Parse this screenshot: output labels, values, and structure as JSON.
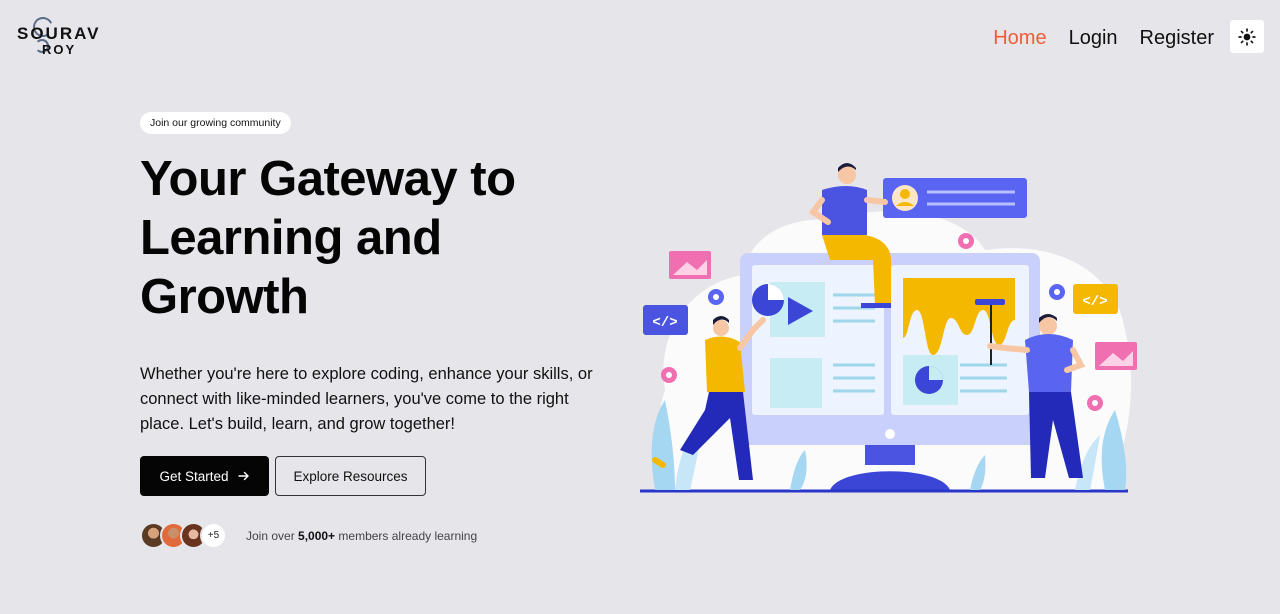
{
  "brand": {
    "line1": "SOURAV",
    "line2": "ROY"
  },
  "nav": {
    "items": [
      {
        "label": "Home",
        "active": true
      },
      {
        "label": "Login",
        "active": false
      },
      {
        "label": "Register",
        "active": false
      }
    ],
    "theme_toggle_icon": "sun-icon"
  },
  "hero": {
    "badge": "Join our growing community",
    "title": "Your Gateway to Learning and Growth",
    "description": "Whether you're here to explore coding, enhance your skills, or connect with like-minded learners, you've come to the right place. Let's build, learn, and grow together!",
    "primary_button": "Get Started",
    "primary_icon": "arrow-right-icon",
    "secondary_button": "Explore Resources",
    "avatars_more": "+5",
    "members_prefix": "Join over ",
    "members_count": "5,000+",
    "members_suffix": " members already learning"
  },
  "colors": {
    "accent": "#f25c3b",
    "background": "#e5e5ea",
    "primary_button": "#050505",
    "illustration_blue": "#3b46d6",
    "illustration_yellow": "#f5b800",
    "illustration_pink": "#f0579a"
  }
}
